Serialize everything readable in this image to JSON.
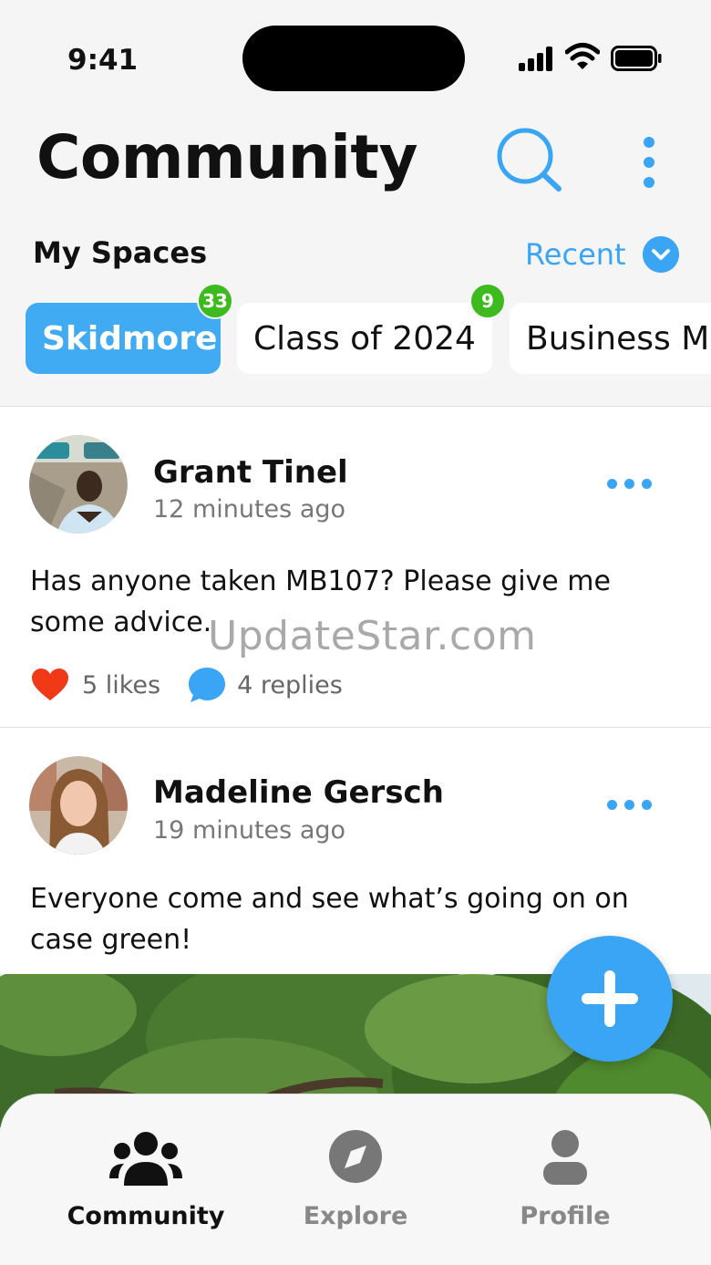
{
  "status_bar": {
    "time": "9:41"
  },
  "header": {
    "title": "Community"
  },
  "spaces": {
    "label": "My Spaces",
    "sort_label": "Recent",
    "chips": [
      {
        "label": "Skidmore",
        "badge": "33",
        "active": true
      },
      {
        "label": "Class of 2024",
        "badge": "9",
        "active": false
      },
      {
        "label": "Business M",
        "badge": "",
        "active": false
      }
    ]
  },
  "posts": [
    {
      "author": "Grant Tinel",
      "time": "12 minutes ago",
      "text": "Has anyone taken MB107? Please give me some advice.",
      "likes": "5 likes",
      "replies": "4 replies"
    },
    {
      "author": "Madeline Gersch",
      "time": "19 minutes ago",
      "text": "Everyone come and see what’s going on on case green!"
    }
  ],
  "watermark": "UpdateStar.com",
  "bottom_nav": {
    "items": [
      {
        "label": "Community",
        "icon": "community-icon",
        "active": true
      },
      {
        "label": "Explore",
        "icon": "compass-icon",
        "active": false
      },
      {
        "label": "Profile",
        "icon": "person-icon",
        "active": false
      }
    ]
  },
  "colors": {
    "accent": "#3aa5f5",
    "badge": "#3dbb1e",
    "like": "#f03a17",
    "nav_active": "#111111",
    "nav_inactive": "#888888"
  }
}
